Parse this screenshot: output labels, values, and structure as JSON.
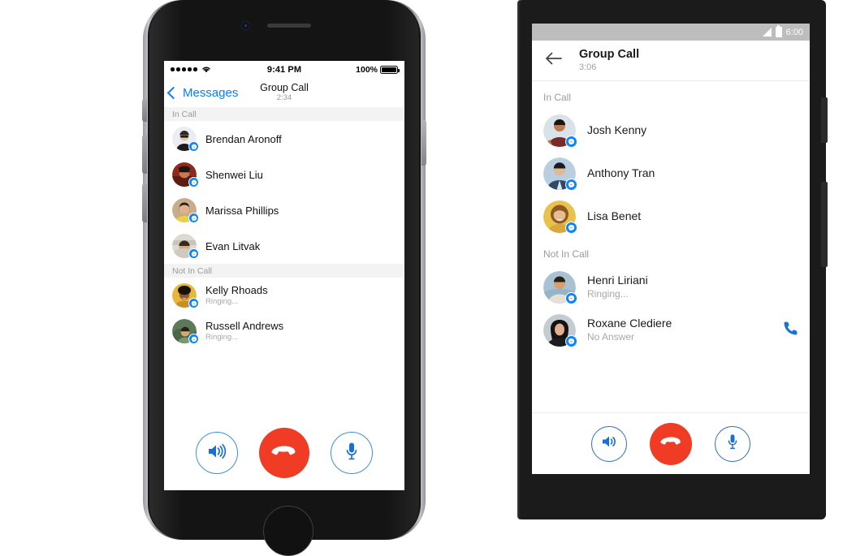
{
  "ios": {
    "status_bar": {
      "signal_dots": 5,
      "wifi_icon": "wifi-icon",
      "time": "9:41 PM",
      "battery_percent": "100%",
      "battery_icon": "battery-full-icon"
    },
    "nav": {
      "back_icon": "chevron-left-icon",
      "back_label": "Messages",
      "title": "Group Call",
      "duration": "2:34"
    },
    "sections": [
      {
        "header": "In Call",
        "contacts": [
          {
            "name": "Brendan Aronoff",
            "status": "",
            "badge_icon": "messenger-badge-icon",
            "avatar_bg": "#e9eef4",
            "skin": "#e8c6a8",
            "hair": "#2f2a27",
            "shirt": "#1c1c1c"
          },
          {
            "name": "Shenwei Liu",
            "status": "",
            "badge_icon": "messenger-badge-icon",
            "avatar_bg": "#8e2a1c",
            "skin": "#c87a52",
            "hair": "#1e1410",
            "shirt": "#5e1d12"
          },
          {
            "name": "Marissa Phillips",
            "status": "",
            "badge_icon": "messenger-badge-icon",
            "avatar_bg": "#c9ad8a",
            "skin": "#e0b18c",
            "hair": "#2a1c14",
            "shirt": "#e8d14a"
          },
          {
            "name": "Evan Litvak",
            "status": "",
            "badge_icon": "messenger-badge-icon",
            "avatar_bg": "#dedad2",
            "skin": "#d8a878",
            "hair": "#3a2a1c",
            "shirt": "#c9c4ba"
          }
        ]
      },
      {
        "header": "Not In Call",
        "contacts": [
          {
            "name": "Kelly Rhoads",
            "status": "Ringing...",
            "badge_icon": "messenger-badge-icon",
            "avatar_bg": "#e8b63a",
            "skin": "#8a5a36",
            "hair": "#1a1208",
            "shirt": "#c98f22"
          },
          {
            "name": "Russell Andrews",
            "status": "Ringing...",
            "badge_icon": "messenger-badge-icon",
            "avatar_bg": "#5d7a58",
            "skin": "#d8a878",
            "hair": "#2a2018",
            "shirt": "#7a9a6e"
          }
        ]
      }
    ],
    "controls": [
      {
        "name": "speaker",
        "icon": "speaker-on-icon",
        "style": "outline"
      },
      {
        "name": "end-call",
        "icon": "end-call-icon",
        "style": "end"
      },
      {
        "name": "microphone",
        "icon": "microphone-icon",
        "style": "outline"
      }
    ]
  },
  "android": {
    "status_bar": {
      "signal_icon": "signal-bars-icon",
      "battery_icon": "battery-icon",
      "time": "6:00"
    },
    "appbar": {
      "back_icon": "arrow-left-icon",
      "title": "Group Call",
      "duration": "3:06"
    },
    "sections": [
      {
        "header": "In Call",
        "contacts": [
          {
            "name": "Josh Kenny",
            "status": "",
            "badge_icon": "messenger-badge-icon",
            "action_icon": "",
            "avatar_bg": "#d8e2e8",
            "skin": "#b77a52",
            "hair": "#1c1410",
            "shirt": "#7a2a28"
          },
          {
            "name": "Anthony Tran",
            "status": "",
            "badge_icon": "messenger-badge-icon",
            "action_icon": "",
            "avatar_bg": "#b9cee0",
            "skin": "#e0b894",
            "hair": "#1a1a20",
            "shirt": "#2e4a66"
          },
          {
            "name": "Lisa Benet",
            "status": "",
            "badge_icon": "messenger-badge-icon",
            "action_icon": "",
            "avatar_bg": "#e8c24a",
            "skin": "#e8bb90",
            "hair": "#8a5a22",
            "shirt": "#d8a840"
          }
        ]
      },
      {
        "header": "Not In Call",
        "contacts": [
          {
            "name": "Henri Liriani",
            "status": "Ringing...",
            "badge_icon": "messenger-badge-icon",
            "action_icon": "",
            "avatar_bg": "#a8c2d2",
            "skin": "#d8a070",
            "hair": "#2a1e16",
            "shirt": "#e4e0d8"
          },
          {
            "name": "Roxane Clediere",
            "status": "No Answer",
            "badge_icon": "messenger-badge-icon",
            "action_icon": "phone-call-icon",
            "avatar_bg": "#c4ccd2",
            "skin": "#e0b090",
            "hair": "#141414",
            "shirt": "#1c1c20"
          }
        ]
      }
    ],
    "controls": [
      {
        "name": "speaker",
        "icon": "speaker-on-icon",
        "style": "outline"
      },
      {
        "name": "end-call",
        "icon": "end-call-icon",
        "style": "end"
      },
      {
        "name": "microphone",
        "icon": "microphone-icon",
        "style": "outline"
      }
    ],
    "navbar": [
      {
        "name": "back",
        "icon": "triangle-back-icon"
      },
      {
        "name": "home",
        "icon": "circle-home-icon"
      },
      {
        "name": "recents",
        "icon": "square-recents-icon"
      }
    ]
  },
  "colors": {
    "ios_accent": "#0a7cff",
    "end_call_red": "#f03c25",
    "outline_blue": "#3f8fd8",
    "badge_blue": "#0a84ff",
    "android_status_gray": "#bdbdbd"
  }
}
